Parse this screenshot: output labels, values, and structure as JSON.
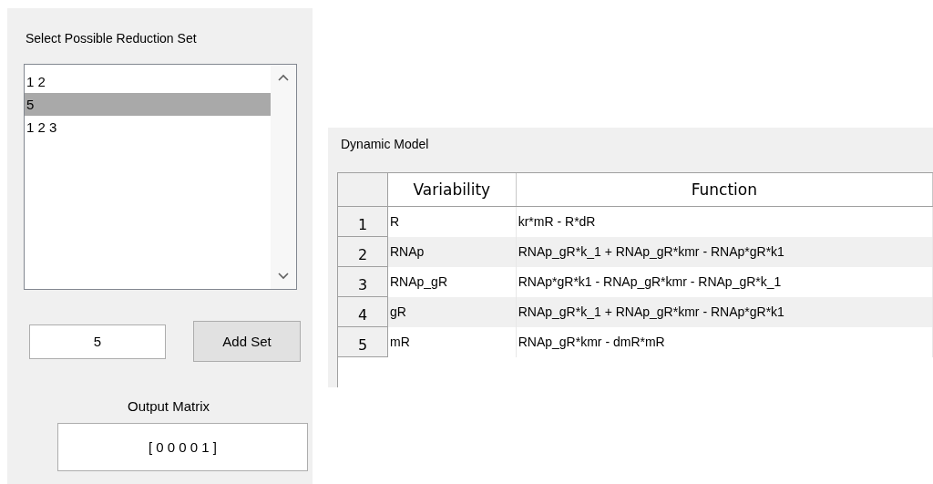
{
  "reduction_panel": {
    "title": "Select Possible Reduction Set",
    "list_items": [
      {
        "label": "1 2",
        "selected": false
      },
      {
        "label": "5",
        "selected": true
      },
      {
        "label": "1 2 3",
        "selected": false
      }
    ],
    "set_input": {
      "value": "5"
    },
    "add_button": "Add Set",
    "output_label": "Output Matrix",
    "output_value": "[ 0 0 0 0 1 ]"
  },
  "model_panel": {
    "title": "Dynamic Model",
    "table": {
      "columns": [
        "Variability",
        "Function"
      ],
      "rows": [
        {
          "index": "1",
          "cells": [
            "R",
            "kr*mR - R*dR"
          ]
        },
        {
          "index": "2",
          "cells": [
            "RNAp",
            "RNAp_gR*k_1 + RNAp_gR*kmr - RNAp*gR*k1"
          ]
        },
        {
          "index": "3",
          "cells": [
            "RNAp_gR",
            "RNAp*gR*k1 - RNAp_gR*kmr - RNAp_gR*k_1"
          ]
        },
        {
          "index": "4",
          "cells": [
            "gR",
            "RNAp_gR*k_1 + RNAp_gR*kmr - RNAp*gR*k1"
          ]
        },
        {
          "index": "5",
          "cells": [
            "mR",
            "RNAp_gR*kmr - dmR*mR"
          ]
        }
      ]
    }
  }
}
